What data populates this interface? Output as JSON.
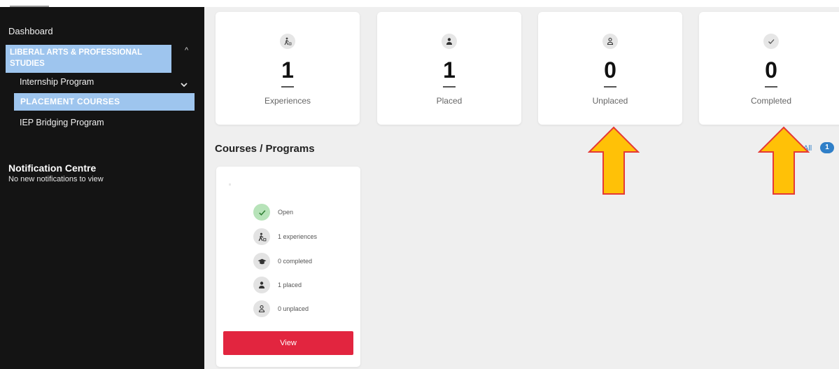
{
  "sidebar": {
    "dashboard": "Dashboard",
    "section_title": "LIBERAL ARTS & PROFESSIONAL STUDIES",
    "section_caret": "^",
    "internship": "Internship Program",
    "placement_courses": "PLACEMENT COURSES",
    "iep": "IEP Bridging Program",
    "notification_title": "Notification Centre",
    "notification_text": "No new notifications to view"
  },
  "stats": [
    {
      "value": "1",
      "label": "Experiences",
      "icon": "walking-person-icon"
    },
    {
      "value": "1",
      "label": "Placed",
      "icon": "person-icon"
    },
    {
      "value": "0",
      "label": "Unplaced",
      "icon": "person-outline-icon"
    },
    {
      "value": "0",
      "label": "Completed",
      "icon": "check-icon"
    }
  ],
  "section": {
    "title": "Courses / Programs",
    "all_label": "All",
    "all_count": "1"
  },
  "course": {
    "items": [
      {
        "text": "Open",
        "icon": "check-icon"
      },
      {
        "text": "1 experiences",
        "icon": "walking-person-icon"
      },
      {
        "text": "0 completed",
        "icon": "graduation-cap-icon"
      },
      {
        "text": "1 placed",
        "icon": "person-icon"
      },
      {
        "text": "0 unplaced",
        "icon": "person-outline-icon"
      }
    ],
    "view_label": "View"
  },
  "colors": {
    "sidebar_bg": "#141414",
    "highlight": "#9ec5ee",
    "view_button": "#e2253f",
    "arrow_fill": "#ffc107",
    "arrow_stroke": "#e53935",
    "badge": "#2f7fc8"
  }
}
